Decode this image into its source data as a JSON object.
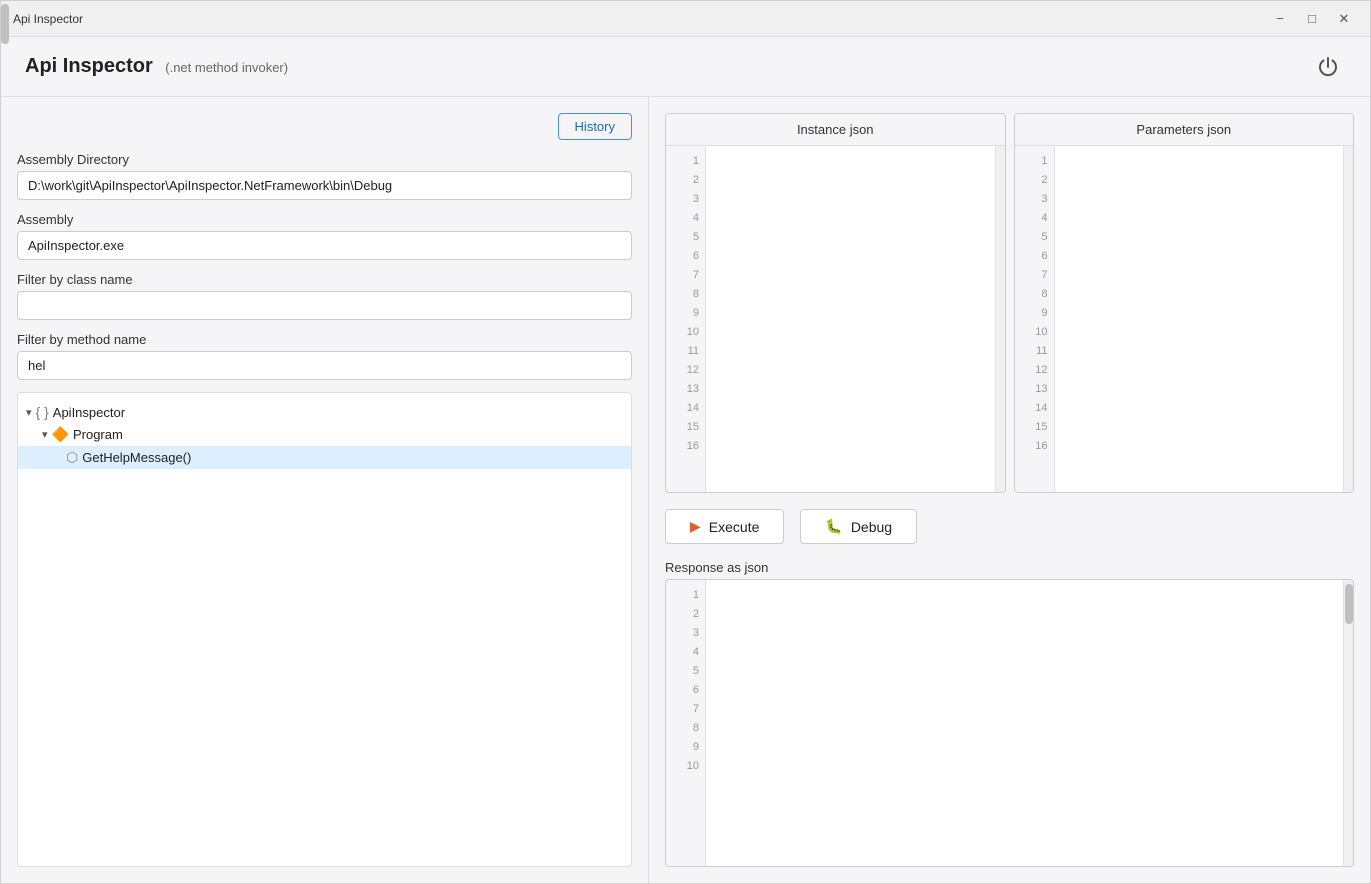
{
  "titleBar": {
    "title": "Api Inspector",
    "minimizeLabel": "−",
    "maximizeLabel": "□",
    "closeLabel": "✕"
  },
  "header": {
    "appTitle": "Api Inspector",
    "subtitle": "(.net method invoker)",
    "powerButtonLabel": "⏻"
  },
  "leftPanel": {
    "historyButton": "History",
    "assemblyDirectoryLabel": "Assembly Directory",
    "assemblyDirectoryValue": "D:\\work\\git\\ApiInspector\\ApiInspector.NetFramework\\bin\\Debug",
    "assemblyLabel": "Assembly",
    "assemblyValue": "ApiInspector.exe",
    "filterByClassLabel": "Filter by class name",
    "filterByClassPlaceholder": "",
    "filterByMethodLabel": "Filter by method name",
    "filterByMethodValue": "hel",
    "tree": {
      "namespace": {
        "label": "ApiInspector",
        "expanded": true
      },
      "class": {
        "label": "Program",
        "expanded": true
      },
      "method": {
        "label": "GetHelpMessage()",
        "selected": true
      }
    }
  },
  "rightPanel": {
    "instanceJsonHeader": "Instance json",
    "parametersJsonHeader": "Parameters json",
    "lineNumbers": [
      1,
      2,
      3,
      4,
      5,
      6,
      7,
      8,
      9,
      10,
      11,
      12,
      13,
      14,
      15,
      16
    ],
    "executeButton": "Execute",
    "debugButton": "Debug",
    "responseLabel": "Response as json",
    "responseLineNumbers": [
      1,
      2,
      3,
      4,
      5,
      6,
      7,
      8,
      9,
      10
    ]
  }
}
